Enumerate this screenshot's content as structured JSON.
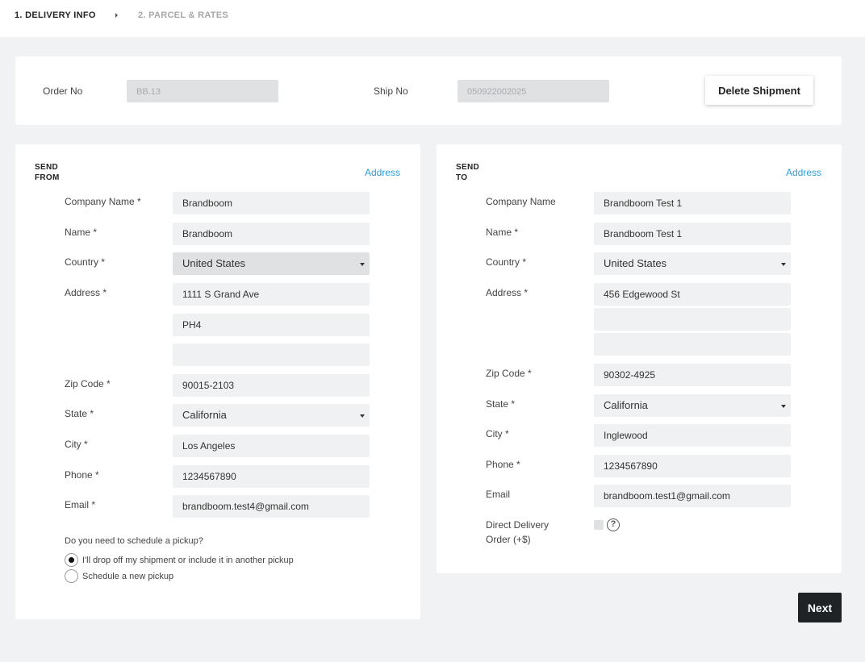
{
  "steps": {
    "step1": "1. DELIVERY INFO",
    "step2": "2. PARCEL & RATES"
  },
  "order": {
    "order_no_label": "Order No",
    "order_no_value": "BB.13",
    "ship_no_label": "Ship No",
    "ship_no_value": "050922002025",
    "delete_label": "Delete Shipment"
  },
  "send_from": {
    "title_line1": "SEND",
    "title_line2": "FROM",
    "address_link": "Address",
    "company_label": "Company Name *",
    "company_value": "Brandboom",
    "name_label": "Name *",
    "name_value": "Brandboom",
    "country_label": "Country *",
    "country_value": "United States",
    "address_label": "Address *",
    "address1": "1111 S Grand Ave",
    "address2": "PH4",
    "address3": "",
    "zip_label": "Zip Code *",
    "zip_value": "90015-2103",
    "state_label": "State *",
    "state_value": "California",
    "city_label": "City *",
    "city_value": "Los Angeles",
    "phone_label": "Phone *",
    "phone_value": "1234567890",
    "email_label": "Email *",
    "email_value": "brandboom.test4@gmail.com",
    "pickup_question": "Do you need to schedule a pickup?",
    "pickup_option1": "I'll drop off my shipment or include it in another pickup",
    "pickup_option2": "Schedule a new pickup"
  },
  "send_to": {
    "title_line1": "SEND",
    "title_line2": "TO",
    "address_link": "Address",
    "company_label": "Company Name",
    "company_value": "Brandboom Test 1",
    "name_label": "Name *",
    "name_value": "Brandboom Test 1",
    "country_label": "Country *",
    "country_value": "United States",
    "address_label": "Address *",
    "address1": "456 Edgewood St",
    "address2": "",
    "address3": "",
    "zip_label": "Zip Code *",
    "zip_value": "90302-4925",
    "state_label": "State *",
    "state_value": "California",
    "city_label": "City *",
    "city_value": "Inglewood",
    "phone_label": "Phone *",
    "phone_value": "1234567890",
    "email_label": "Email",
    "email_value": "brandboom.test1@gmail.com",
    "direct_label_line1": "Direct Delivery",
    "direct_label_line2": "Order (+$)",
    "help_glyph": "?"
  },
  "next_label": "Next"
}
